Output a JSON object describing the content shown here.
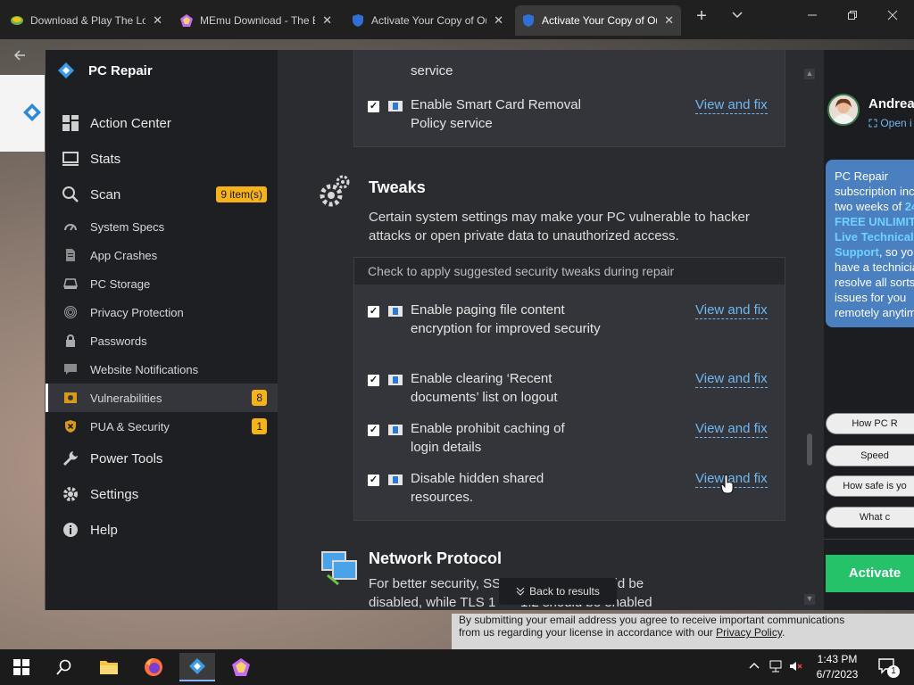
{
  "browser": {
    "tabs": [
      {
        "title": "Download & Play The Lo",
        "active": false
      },
      {
        "title": "MEmu Download - The B",
        "active": false
      },
      {
        "title": "Activate Your Copy of Ou",
        "active": false
      },
      {
        "title": "Activate Your Copy of Ou",
        "active": true
      }
    ],
    "new_tab_label": "+",
    "tab_list_label": "⌄"
  },
  "app": {
    "name": "PC Repair",
    "nav": [
      {
        "label": "Action Center",
        "icon": "dashboard-icon",
        "sub": false
      },
      {
        "label": "Stats",
        "icon": "monitor-icon",
        "sub": false
      },
      {
        "label": "Scan",
        "icon": "search-icon",
        "sub": false,
        "badge": "9 item(s)"
      },
      {
        "label": "System Specs",
        "icon": "gauge-icon",
        "sub": true
      },
      {
        "label": "App Crashes",
        "icon": "document-icon",
        "sub": true
      },
      {
        "label": "PC Storage",
        "icon": "drive-icon",
        "sub": true
      },
      {
        "label": "Privacy Protection",
        "icon": "fingerprint-icon",
        "sub": true
      },
      {
        "label": "Passwords",
        "icon": "lock-icon",
        "sub": true
      },
      {
        "label": "Website Notifications",
        "icon": "chat-icon",
        "sub": true
      },
      {
        "label": "Vulnerabilities",
        "icon": "vault-icon",
        "sub": true,
        "badge": "8",
        "selected": true
      },
      {
        "label": "PUA & Security",
        "icon": "shield-x-icon",
        "sub": true,
        "badge": "1"
      },
      {
        "label": "Power Tools",
        "icon": "wrench-icon",
        "sub": false
      },
      {
        "label": "Settings",
        "icon": "gear-icon",
        "sub": false
      },
      {
        "label": "Help",
        "icon": "info-icon",
        "sub": false
      }
    ]
  },
  "content": {
    "top_card": {
      "partial_text": "service",
      "row": {
        "text": "Enable Smart Card Removal Policy service",
        "action": "View and fix"
      }
    },
    "tweaks": {
      "title": "Tweaks",
      "description": "Certain system settings may make your PC vulnerable to hacker attacks or open private data to unauthorized access.",
      "header": "Check to apply suggested security tweaks during repair",
      "rows": [
        {
          "text": "Enable paging file content encryption for improved security",
          "action": "View and fix"
        },
        {
          "text": "Enable clearing ‘Recent documents’ list on logout",
          "action": "View and fix"
        },
        {
          "text": "Enable prohibit caching of login details",
          "action": "View and fix"
        },
        {
          "text": "Disable hidden shared resources.",
          "action": "View and fix"
        }
      ]
    },
    "network": {
      "title": "Network Protocol",
      "desc_line1": "For better security, SS",
      "desc_line1_end": "protocols should be",
      "desc_line2": "disabled, while TLS 1",
      "desc_line2_end": "1.2 should be enabled"
    },
    "back_to_results": "Back to results"
  },
  "support": {
    "agent_name": "Andrea",
    "open_link": "Open i",
    "bubble_lines": [
      "PC Repair",
      "subscription inc",
      "two weeks of "
    ],
    "bubble_hl_inline": "24",
    "bubble_hl_lines": [
      "FREE UNLIMITE",
      "Live Technical",
      "Support"
    ],
    "bubble_tail": [
      ", so yo",
      "have a technicia",
      "resolve all sorts",
      "issues for you",
      "remotely anytim"
    ],
    "pills": [
      "How PC R",
      "Speed",
      "How safe is yo",
      "What c"
    ],
    "activate_label": "Activate"
  },
  "page": {
    "consent_line1": "By submitting your email address you agree to receive important communications",
    "consent_line2_prefix": "from us regarding your license in accordance with our ",
    "consent_link": "Privacy Policy",
    "consent_line2_suffix": "."
  },
  "taskbar": {
    "time": "1:43 PM",
    "date": "6/7/2023",
    "notifications": "1"
  }
}
